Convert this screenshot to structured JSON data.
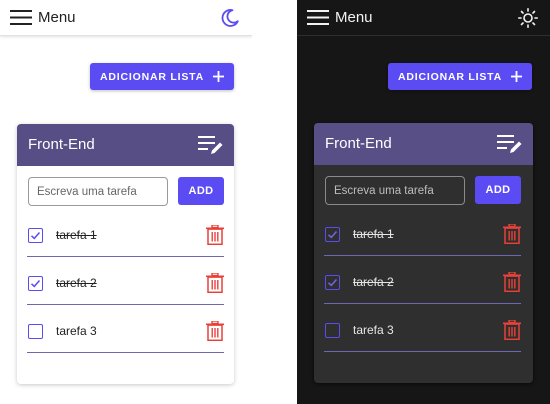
{
  "theme_panels": [
    {
      "theme": "light",
      "theme_toggle_icon": "moon-icon"
    },
    {
      "theme": "dark",
      "theme_toggle_icon": "sun-icon"
    }
  ],
  "topbar": {
    "menu_label": "Menu",
    "menu_icon": "hamburger-icon"
  },
  "toolbar": {
    "add_list_label": "ADICIONAR LISTA",
    "add_list_icon": "plus-icon"
  },
  "list": {
    "title": "Front-End",
    "edit_icon": "edit-list-icon",
    "input_placeholder": "Escreva uma tarefa",
    "input_value": "",
    "add_button_label": "ADD",
    "tasks": [
      {
        "label": "tarefa 1",
        "done": true
      },
      {
        "label": "tarefa 2",
        "done": true
      },
      {
        "label": "tarefa 3",
        "done": false
      }
    ]
  },
  "colors": {
    "accent": "#5b4bf2",
    "header_bg": "#564e84",
    "delete_red": "#e8413a",
    "dark_bg": "#161616",
    "dark_card": "#2f2f2f",
    "moon": "#5b4bf2"
  }
}
